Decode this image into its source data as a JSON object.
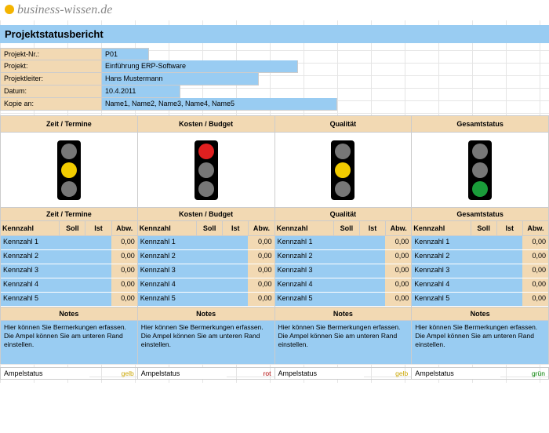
{
  "logo_text": "business-wissen.de",
  "title": "Projektstatusbericht",
  "meta": [
    {
      "label": "Projekt-Nr.:",
      "value": "P01",
      "w": 0
    },
    {
      "label": "Projekt:",
      "value": "Einführung ERP-Software",
      "w": 1
    },
    {
      "label": "Projektleiter:",
      "value": "Hans Mustermann",
      "w": 2
    },
    {
      "label": "Datum:",
      "value": "10.4.2011",
      "w": 3
    },
    {
      "label": "Kopie an:",
      "value": "Name1, Name2, Name3, Name4, Name5",
      "w": 4
    }
  ],
  "col_labels": {
    "kennzahl": "Kennzahl",
    "soll": "Soll",
    "ist": "Ist",
    "abw": "Abw."
  },
  "notes_label": "Notes",
  "notes_text": "Hier können Sie Bermerkungen erfassen. Die Ampel können Sie am unteren Rand einstellen.",
  "footer_label": "Ampelstatus",
  "categories": [
    {
      "name": "Zeit / Termine",
      "light": "yellow",
      "status": "gelb"
    },
    {
      "name": "Kosten / Budget",
      "light": "red",
      "status": "rot"
    },
    {
      "name": "Qualität",
      "light": "yellow",
      "status": "gelb"
    },
    {
      "name": "Gesamtstatus",
      "light": "green",
      "status": "grün"
    }
  ],
  "kpi_rows": [
    {
      "name": "Kennzahl 1",
      "soll": "",
      "ist": "",
      "abw": "0,00"
    },
    {
      "name": "Kennzahl 2",
      "soll": "",
      "ist": "",
      "abw": "0,00"
    },
    {
      "name": "Kennzahl 3",
      "soll": "",
      "ist": "",
      "abw": "0,00"
    },
    {
      "name": "Kennzahl 4",
      "soll": "",
      "ist": "",
      "abw": "0,00"
    },
    {
      "name": "Kennzahl 5",
      "soll": "",
      "ist": "",
      "abw": "0,00"
    }
  ]
}
